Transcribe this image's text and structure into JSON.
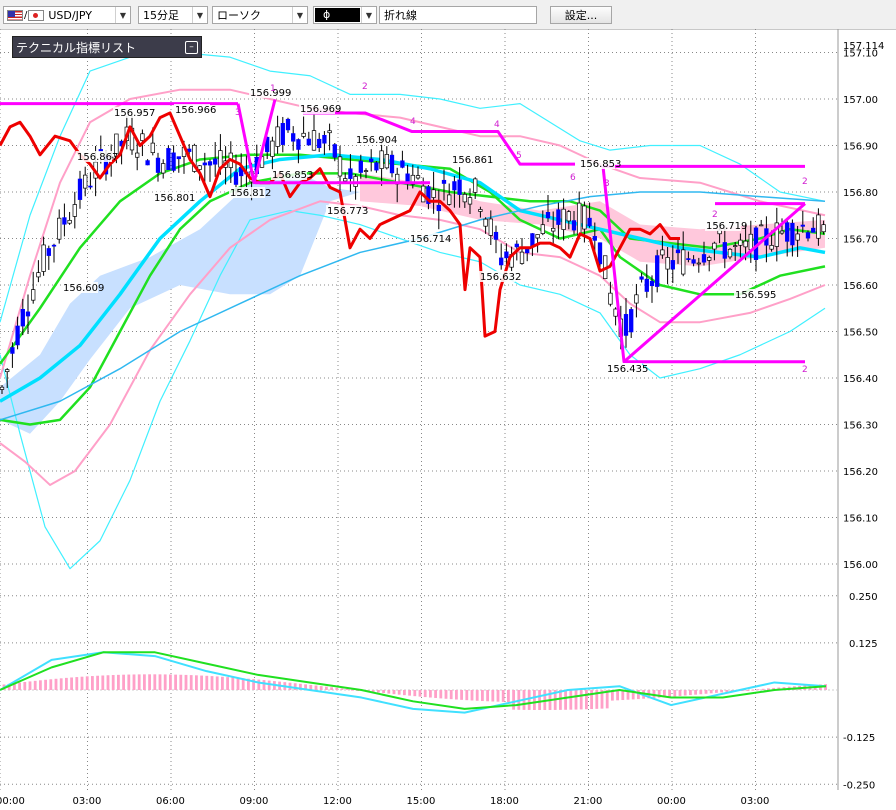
{
  "toolbar": {
    "symbol": "USD/JPY",
    "timeframe": "15分足",
    "chart_style": "ローソク",
    "sub_field": "ϕ",
    "line_type": "折れ線",
    "settings_label": "設定..."
  },
  "panel": {
    "title": "テクニカル指標リスト",
    "minimize_icon": "minimize-icon"
  },
  "colors": {
    "candle_up": "#ffffff",
    "candle_down": "#0000ff",
    "ma_cyan": "#00e0ff",
    "bb_pink": "#ffa0c8",
    "bb_cyan": "#40f0ff",
    "ma_green": "#20e020",
    "tenkan_red": "#ee0000",
    "wave_magenta": "#ff00ff",
    "cloud": "#c8e0ff"
  },
  "chart_data": [
    {
      "type": "candlestick",
      "title": "",
      "x_ticks": [
        "00:00",
        "03:00",
        "06:00",
        "09:00",
        "12:00",
        "15:00",
        "18:00",
        "21:00",
        "00:00",
        "03:00"
      ],
      "y_ticks": [
        "157.10",
        "157.00",
        "156.90",
        "156.80",
        "156.70",
        "156.60",
        "156.50",
        "156.40",
        "156.30",
        "156.20",
        "156.10",
        "156.00"
      ],
      "y_range": [
        155.99,
        157.12
      ],
      "current_price_label": "157.114",
      "price_labels": [
        "156.999",
        "156.969",
        "156.957",
        "156.966",
        "156.867",
        "156.801",
        "156.812",
        "156.853",
        "156.904",
        "156.861",
        "156.853",
        "156.773",
        "156.714",
        "156.609",
        "156.632",
        "156.719",
        "156.435",
        "156.595"
      ],
      "wave_labels": [
        "1",
        "2",
        "3",
        "4",
        "4",
        "5",
        "6",
        "3",
        "2",
        "2",
        "2"
      ]
    },
    {
      "type": "line",
      "title": "",
      "y_ticks": [
        "0.250",
        "0.125",
        "-0.125",
        "-0.250"
      ],
      "y_range": [
        -0.25,
        0.25
      ],
      "series": [
        {
          "values": [
            0,
            0.08,
            0.1,
            0.09,
            0.05,
            0.02,
            0,
            -0.02,
            -0.05,
            -0.06,
            -0.03,
            0,
            0.01,
            -0.04,
            -0.01,
            0.02,
            0.01
          ]
        },
        {
          "values": [
            0,
            0.06,
            0.1,
            0.1,
            0.07,
            0.04,
            0.02,
            0,
            -0.03,
            -0.05,
            -0.04,
            -0.02,
            0,
            -0.02,
            -0.02,
            0,
            0.01
          ]
        }
      ]
    }
  ]
}
